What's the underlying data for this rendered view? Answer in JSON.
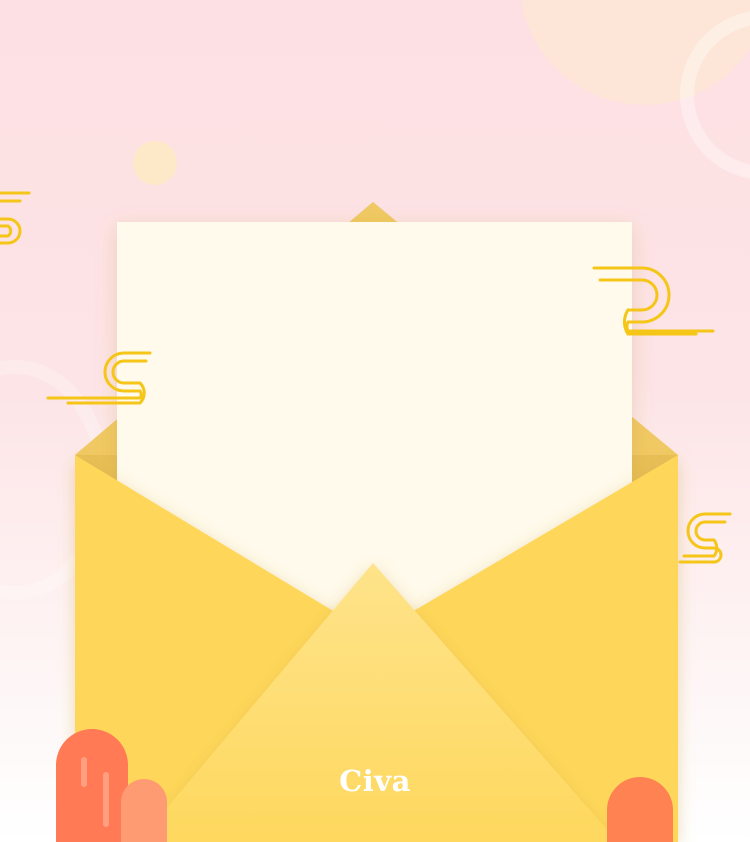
{
  "brand": {
    "logo_text": "Civa"
  },
  "colors": {
    "background_top": "#fde0e3",
    "background_bottom": "#ffffff",
    "envelope_yellow": "#fed75a",
    "envelope_front_flap": "#fedb6a",
    "letter_paper": "#fffaec",
    "cloud_stroke": "#f5c518",
    "capsule_red": "#ff7a55",
    "capsule_salmon": "#ff9b73"
  },
  "icons": [
    "sun-circle",
    "cloud-swirl-icon",
    "envelope-icon",
    "letter-paper",
    "capsule-decoration"
  ]
}
